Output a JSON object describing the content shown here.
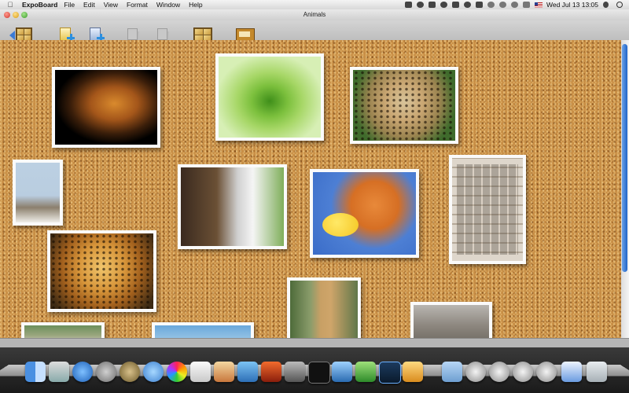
{
  "menubar": {
    "app_name": "ExpoBoard",
    "menus": [
      "File",
      "Edit",
      "View",
      "Format",
      "Window",
      "Help"
    ],
    "clock": "Wed Jul 13  13:05",
    "status_icons": [
      "evernote-icon",
      "alien-icon",
      "dropbox-icon",
      "cloud-icon",
      "printer-icon",
      "timemachine-icon",
      "battery-icon",
      "sync-icon",
      "history-icon",
      "wifi-icon",
      "volume-icon",
      "us-flag-icon"
    ],
    "user_icon": "user-icon",
    "search_icon": "spotlight-search-icon"
  },
  "window": {
    "title": "Animals"
  },
  "toolbar": {
    "buttons": [
      {
        "name": "back-button",
        "icon": "back-arrow-icon"
      },
      {
        "name": "add-note-button",
        "icon": "note-add-icon"
      },
      {
        "name": "add-photo-button",
        "icon": "photo-add-icon"
      },
      {
        "name": "disabled-button-1",
        "icon": "copy-icon"
      },
      {
        "name": "disabled-button-2",
        "icon": "paste-icon"
      },
      {
        "name": "arrange-button",
        "icon": "grid-icon"
      },
      {
        "name": "board-button",
        "icon": "board-icon"
      }
    ]
  },
  "board": {
    "photos": [
      "lion",
      "green-snake",
      "cheetah",
      "marabou-stork",
      "puppy-and-kitten",
      "kitten-and-duckling",
      "animal-collage",
      "jaguar",
      "giraffe",
      "wolf",
      "sheep",
      "sky-landscape"
    ]
  },
  "dock": {
    "apps": [
      "finder",
      "preview",
      "safari",
      "ical",
      "ichat",
      "itunes",
      "textedit",
      "system-preferences",
      "dictionary",
      "app-store",
      "utilities",
      "terminal",
      "iphoto",
      "downloader",
      "photoshop",
      "mail",
      "folder",
      "server-1",
      "server-2",
      "server-3",
      "server-4",
      "itunes-stack",
      "trash"
    ]
  },
  "colors": {
    "cork": "#c88e45",
    "scroll_thumb": "#1f63c7",
    "toolbar_accent": "#2c8fdf"
  }
}
